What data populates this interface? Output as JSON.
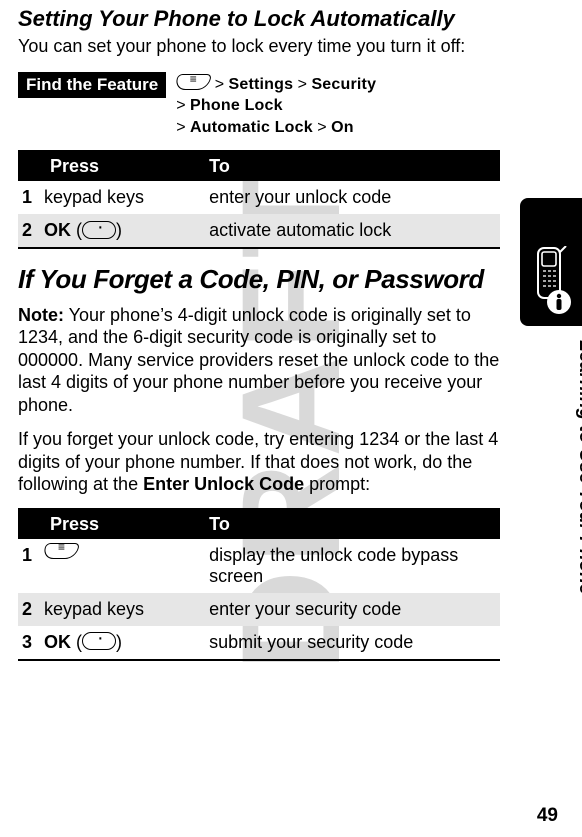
{
  "watermark": "DRAFT",
  "section1": {
    "title": "Setting Your Phone to Lock Automatically",
    "intro": "You can set your phone to lock every time you turn it off:"
  },
  "feature": {
    "label": "Find the Feature",
    "line1_prefix": "> ",
    "line1_a": "Settings",
    "line1_b": " > ",
    "line1_c": "Security",
    "line2_prefix": "> ",
    "line2_a": "Phone Lock",
    "line3_prefix": "> ",
    "line3_a": "Automatic Lock",
    "line3_b": " > ",
    "line3_c": "On"
  },
  "table1": {
    "h1": "Press",
    "h2": "To",
    "rows": [
      {
        "n": "1",
        "press": "keypad keys",
        "to": "enter your unlock code",
        "alt": false,
        "softkey": false,
        "ok": ""
      },
      {
        "n": "2",
        "press": "",
        "to": "activate automatic lock",
        "alt": true,
        "softkey": true,
        "ok": "OK"
      }
    ]
  },
  "section2": {
    "title": "If You Forget a Code, PIN, or Password",
    "note_label": "Note:",
    "note": " Your phone’s 4-digit unlock code is originally set to 1234, and the 6-digit security code is originally set to 000000. Many service providers reset the unlock code to the last 4 digits of your phone number before you receive your phone.",
    "para_a": "If you forget your unlock code, try entering 1234 or the last 4 digits of your phone number. If that does not work, do the following at the ",
    "para_prompt": "Enter Unlock Code",
    "para_b": " prompt:"
  },
  "table2": {
    "h1": "Press",
    "h2": "To",
    "rows": [
      {
        "n": "1",
        "press": "",
        "to": "display the unlock code bypass screen",
        "alt": false,
        "menukey": true,
        "softkey": false,
        "ok": ""
      },
      {
        "n": "2",
        "press": "keypad keys",
        "to": "enter your security code",
        "alt": true,
        "menukey": false,
        "softkey": false,
        "ok": ""
      },
      {
        "n": "3",
        "press": "",
        "to": "submit your security code",
        "alt": false,
        "menukey": false,
        "softkey": true,
        "ok": "OK"
      }
    ]
  },
  "side_label": "Learning to Use Your Phone",
  "page_number": "49"
}
